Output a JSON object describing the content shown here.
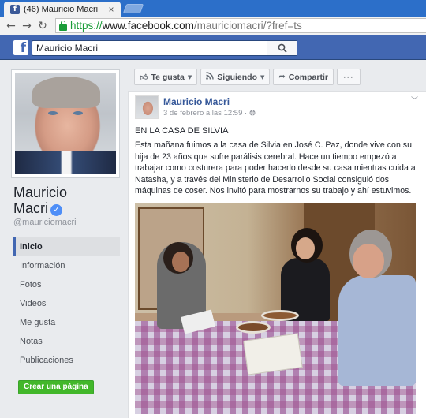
{
  "browser": {
    "tab_title": "(46) Mauricio Macri",
    "tab_favicon": "f",
    "tab_close": "×",
    "url_scheme": "https://",
    "url_host": "www.facebook.com",
    "url_path": "/mauriciomacri/?fref=ts"
  },
  "fbbar": {
    "logo": "f",
    "search_value": "Mauricio Macri"
  },
  "profile": {
    "name_line1": "Mauricio",
    "name_line2": "Macri",
    "verified_mark": "✓",
    "handle": "@mauriciomacri"
  },
  "leftnav": {
    "items": [
      {
        "label": "Inicio",
        "active": true
      },
      {
        "label": "Información"
      },
      {
        "label": "Fotos"
      },
      {
        "label": "Videos"
      },
      {
        "label": "Me gusta"
      },
      {
        "label": "Notas"
      },
      {
        "label": "Publicaciones"
      }
    ],
    "create_page": "Crear una página"
  },
  "actions": {
    "like": "Te gusta",
    "following": "Siguiendo",
    "share": "Compartir",
    "more": "···"
  },
  "post": {
    "author": "Mauricio Macri",
    "date": "3 de febrero a las 12:59 · ",
    "heading": "EN LA CASA DE SILVIA",
    "body": "Esta mañana fuimos a la casa de Silvia en José C. Paz, donde vive con su hija de 23 años que sufre parálisis cerebral. Hace un tiempo empezó a trabajar como costurera para poder hacerlo desde su casa mientras cuida a Natasha, y a través del Ministerio de Desarrollo Social consiguió dos máquinas de coser. Nos invitó para mostrarnos su trabajo y ahí estuvimos."
  },
  "colors": {
    "fb_blue": "#4267b2",
    "link_blue": "#365899",
    "green": "#42b72a",
    "chrome_blue": "#2c6fc9"
  }
}
